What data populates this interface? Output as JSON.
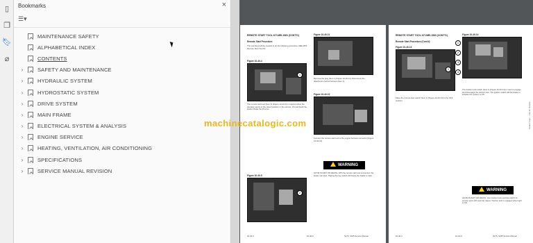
{
  "toolstrip": {
    "icons": [
      "pages-icon",
      "copy-icon",
      "bookmark-icon",
      "attachment-icon"
    ]
  },
  "panel": {
    "title": "Bookmarks",
    "close_label": "×",
    "bookmarks": [
      {
        "label": "MAINTENANCE SAFETY",
        "expandable": false
      },
      {
        "label": "ALPHABETICAL INDEX",
        "expandable": false
      },
      {
        "label": "CONTENTS",
        "expandable": false,
        "selected": true
      },
      {
        "label": "SAFETY AND MAINTENANCE",
        "expandable": true
      },
      {
        "label": "HYDRAULIC SYSTEM",
        "expandable": true
      },
      {
        "label": "HYDROSTATIC SYSTEM",
        "expandable": true
      },
      {
        "label": "DRIVE SYSTEM",
        "expandable": true
      },
      {
        "label": "MAIN FRAME",
        "expandable": true
      },
      {
        "label": "ELECTRICAL SYSTEM & ANALYSIS",
        "expandable": true
      },
      {
        "label": "ENGINE SERVICE",
        "expandable": true
      },
      {
        "label": "HEATING, VENTILATION, AIR CONDITIONING",
        "expandable": true
      },
      {
        "label": "SPECIFICATIONS",
        "expandable": true
      },
      {
        "label": "SERVICE MANUAL REVISION",
        "expandable": true
      }
    ]
  },
  "watermark": "machinecatalogic.com",
  "page_left": {
    "header": "REMOTE START TOOL KIT-MEL1563 (CONT'D)",
    "subhead": "Remote Start Procedure",
    "fig_a": "Figure 10-40-4",
    "fig_b": "Figure 10-40-5",
    "fig_c": "Figure 10-40-11",
    "fig_d": "Figure 10-40-12",
    "warning": "WARNING",
    "footer_left": "10-40-3",
    "footer_mid": "10-40-6",
    "footer_right": "S175, S185 Service Manual"
  },
  "page_right": {
    "header": "REMOTE START TOOL KIT-MEL1563 (CONT'D)",
    "subhead": "Remote Start Procedure (Cont'd)",
    "fig_a": "Figure 10-40-13",
    "fig_b": "Figure 10-40-14",
    "warning": "WARNING",
    "side_text": "Dealer Copy -- Not for Resale",
    "footer_left": "10-40-3",
    "footer_mid": "10-40-6",
    "footer_right": "S175, S185 Service Manual"
  }
}
